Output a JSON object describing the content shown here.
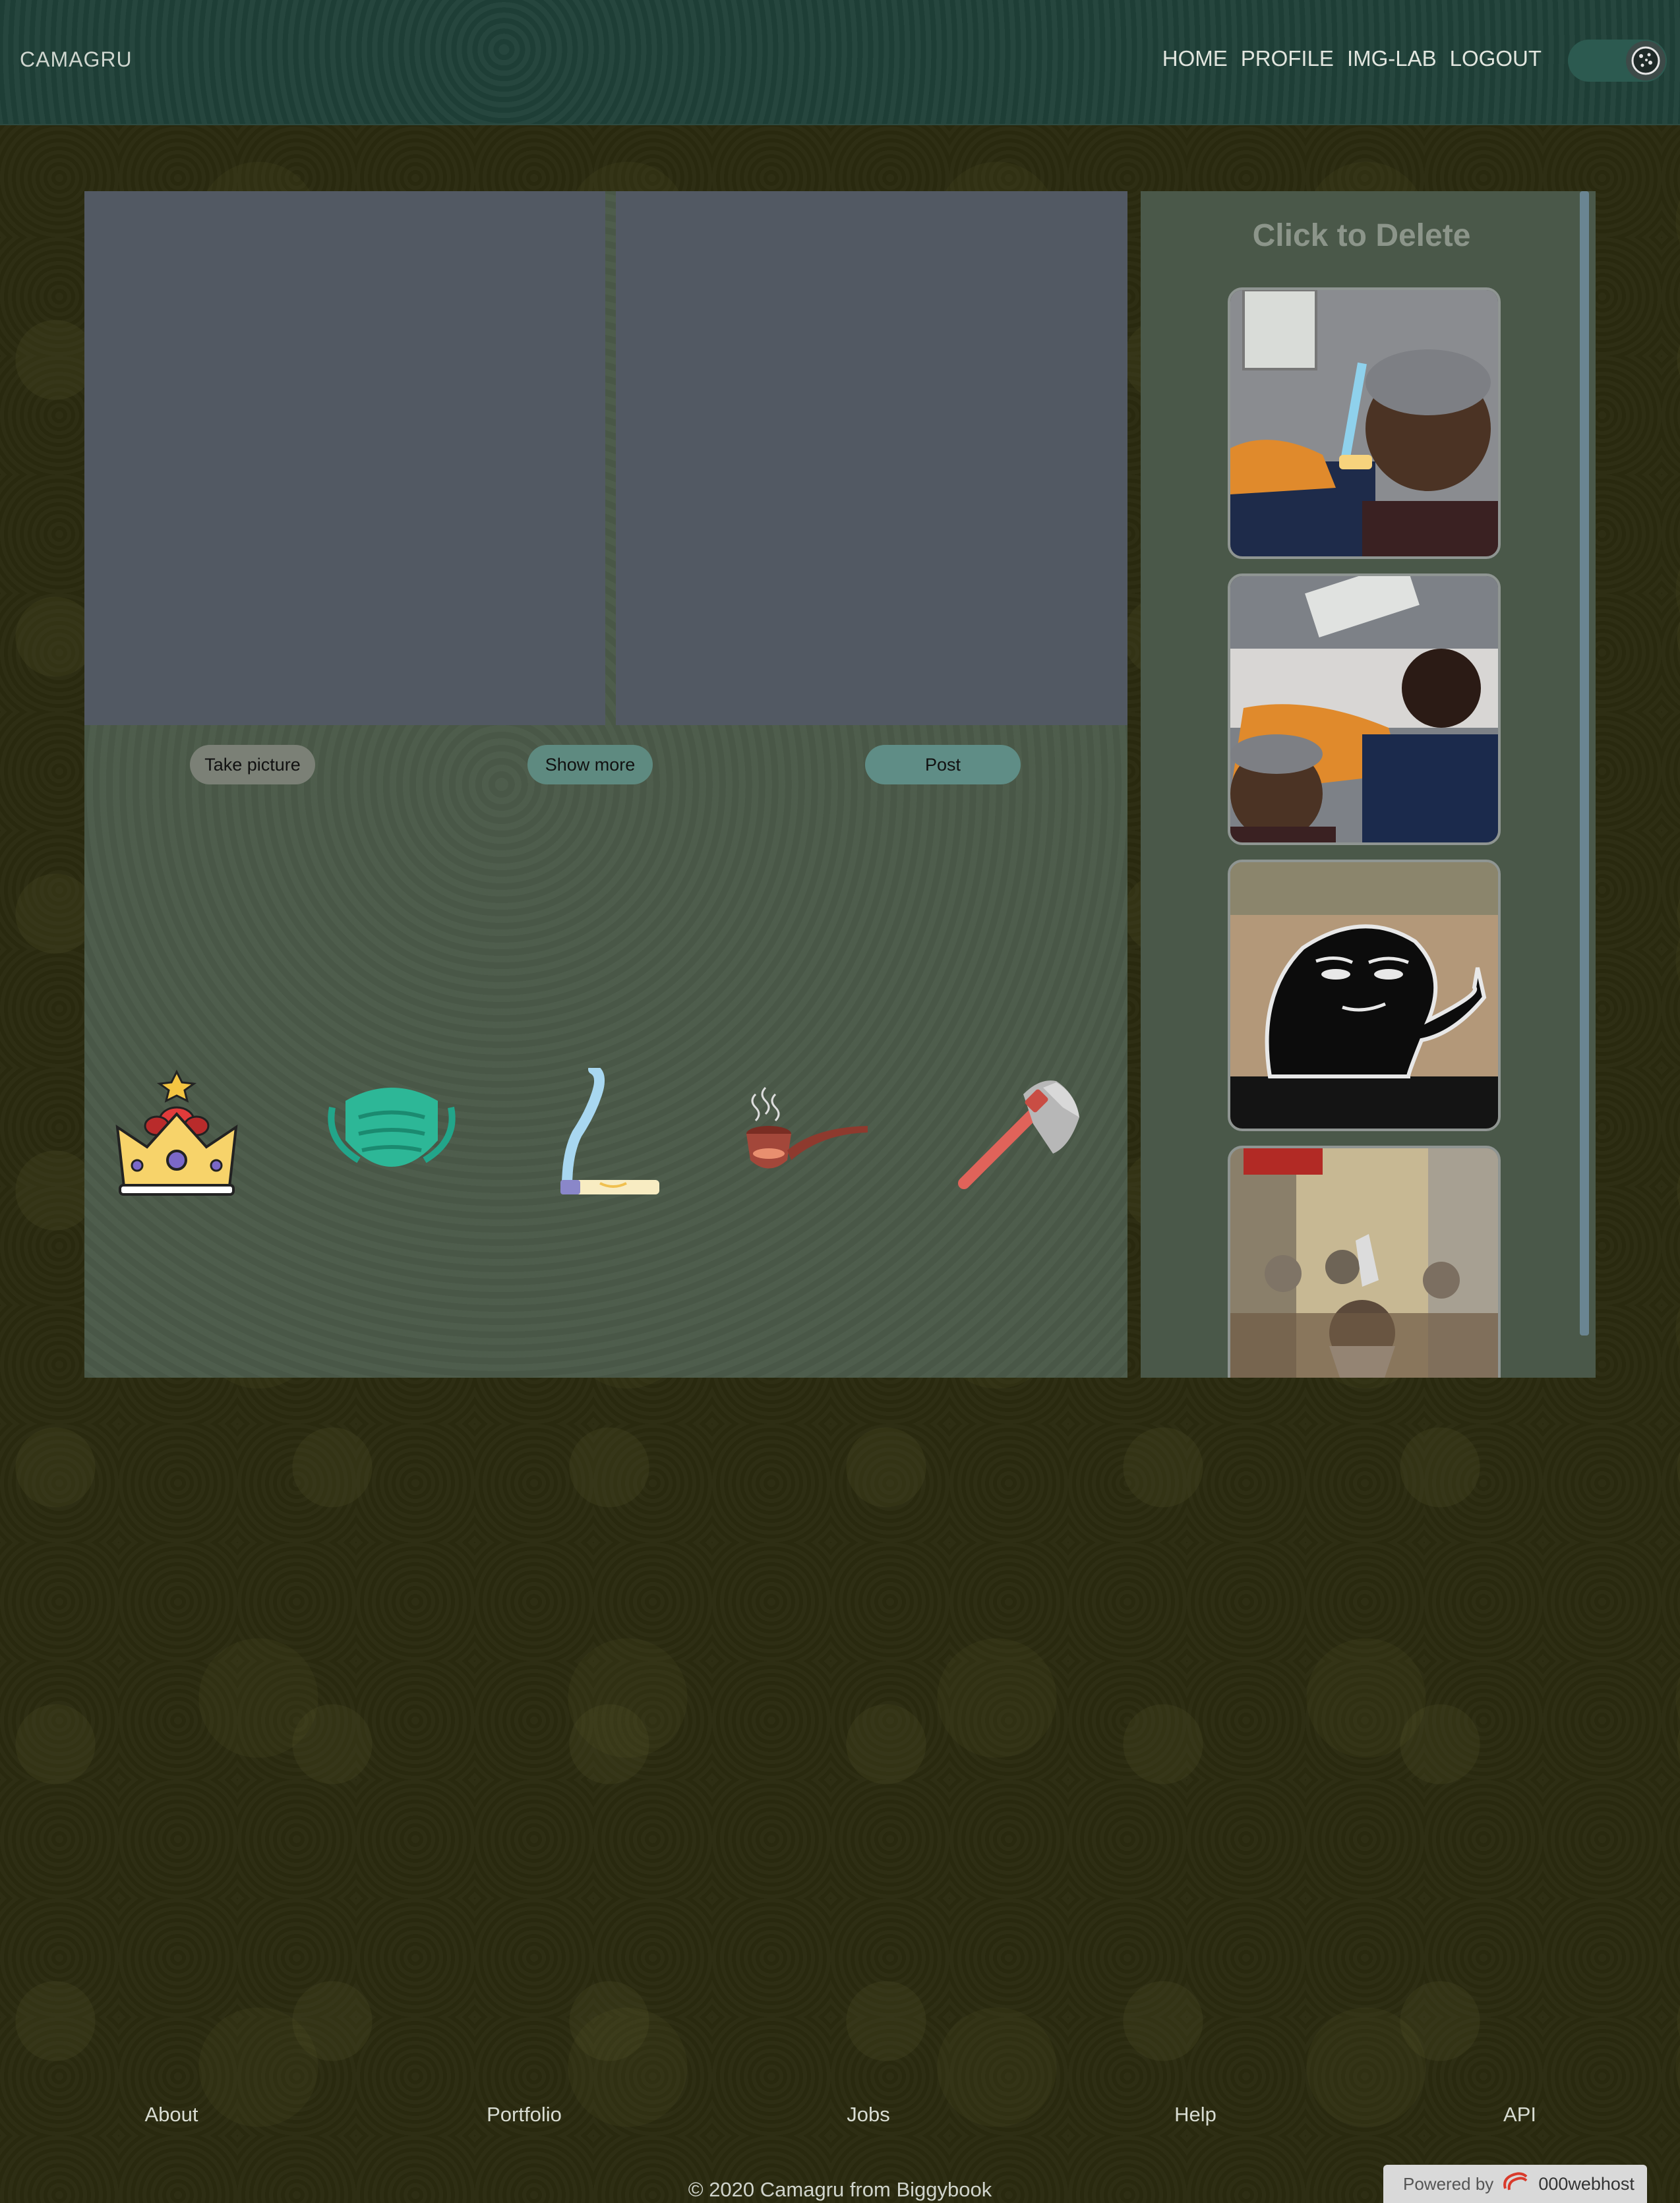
{
  "header": {
    "brand": "CAMAGRU",
    "nav": [
      "HOME",
      "PROFILE",
      "IMG-LAB",
      "LOGOUT"
    ],
    "theme_toggle_icon": "cookie-icon"
  },
  "controls": {
    "take_picture": "Take picture",
    "show_more": "Show more",
    "post": "Post"
  },
  "stickers": [
    {
      "name": "crown-icon"
    },
    {
      "name": "face-mask-icon"
    },
    {
      "name": "cigarette-icon"
    },
    {
      "name": "pipe-icon"
    },
    {
      "name": "axe-icon"
    }
  ],
  "sidebar": {
    "title": "Click to Delete",
    "thumbnails": [
      {
        "description": "selfie with cigarette sticker"
      },
      {
        "description": "selfie of two people"
      },
      {
        "description": "meme character"
      },
      {
        "description": "game screenshot with axe sticker"
      }
    ]
  },
  "footer": {
    "links": [
      "About",
      "Portfolio",
      "Jobs",
      "Help",
      "API"
    ],
    "copyright": "© 2020 Camagru from Biggybook",
    "powered_by": "Powered by",
    "host": "000webhost"
  }
}
